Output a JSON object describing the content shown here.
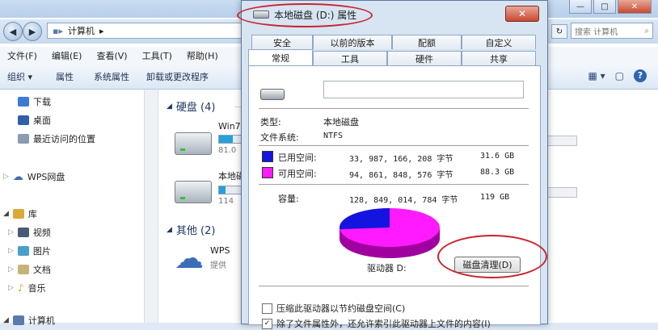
{
  "explorer": {
    "breadcrumb": [
      "▪",
      "计算机"
    ],
    "search_placeholder": "搜索 计算机",
    "menu": [
      "文件(F)",
      "编辑(E)",
      "查看(V)",
      "工具(T)",
      "帮助(H)"
    ],
    "commands": [
      "组织 ▾",
      "属性",
      "系统属性",
      "卸载或更改程序"
    ],
    "nav": {
      "items": [
        {
          "label": "下载",
          "icon": "download-folder-icon",
          "color": "#3a7bd5"
        },
        {
          "label": "桌面",
          "icon": "desktop-icon",
          "color": "#2f5fa8"
        },
        {
          "label": "最近访问的位置",
          "icon": "recent-places-icon",
          "color": "#8a9bb3"
        },
        {
          "label": "WPS网盘",
          "icon": "cloud-icon",
          "color": "#3a6fb8"
        },
        {
          "label": "库",
          "icon": "library-icon",
          "color": "#d9a93a"
        },
        {
          "label": "视频",
          "icon": "video-icon",
          "color": "#4a5b7a"
        },
        {
          "label": "图片",
          "icon": "pictures-icon",
          "color": "#4aa0c8"
        },
        {
          "label": "文档",
          "icon": "documents-icon",
          "color": "#c9b27a"
        },
        {
          "label": "音乐",
          "icon": "music-icon",
          "color": "#e0a020"
        },
        {
          "label": "计算机",
          "icon": "computer-icon",
          "color": "#5a7bab"
        }
      ]
    },
    "groups": {
      "hard_disks": "硬盘 (4)",
      "other": "其他 (2)"
    },
    "drives": [
      {
        "name": "Win7",
        "sub": "81.0",
        "fill": 0.55
      },
      {
        "name": "本地磁",
        "sub": "114",
        "fill": 0.25
      }
    ],
    "other_items": [
      {
        "name": "WPS",
        "sub": "提供"
      }
    ]
  },
  "dialog": {
    "title": "本地磁盘 (D:) 属性",
    "close": "✕",
    "tabs_row1": [
      "安全",
      "以前的版本",
      "配额",
      "自定义"
    ],
    "tabs_row2": [
      "常规",
      "工具",
      "硬件",
      "共享"
    ],
    "type_label": "类型:",
    "type_value": "本地磁盘",
    "fs_label": "文件系统:",
    "fs_value": "NTFS",
    "used_label": "已用空间:",
    "used_bytes": "33, 987, 166, 208 字节",
    "used_gb": "31.6 GB",
    "free_label": "可用空间:",
    "free_bytes": "94, 861, 848, 576 字节",
    "free_gb": "88.3 GB",
    "capacity_label": "容量:",
    "capacity_bytes": "128, 849, 014, 784 字节",
    "capacity_gb": "119 GB",
    "drive_label": "驱动器 D:",
    "cleanup_button": "磁盘清理(D)",
    "compress_label": "压缩此驱动器以节约磁盘空间(C)",
    "index_label": "除了文件属性外，还允许索引此驱动器上文件的内容(I)",
    "colors": {
      "used": "#1414e0",
      "free": "#ff1aff"
    },
    "used_fraction": 0.264
  }
}
